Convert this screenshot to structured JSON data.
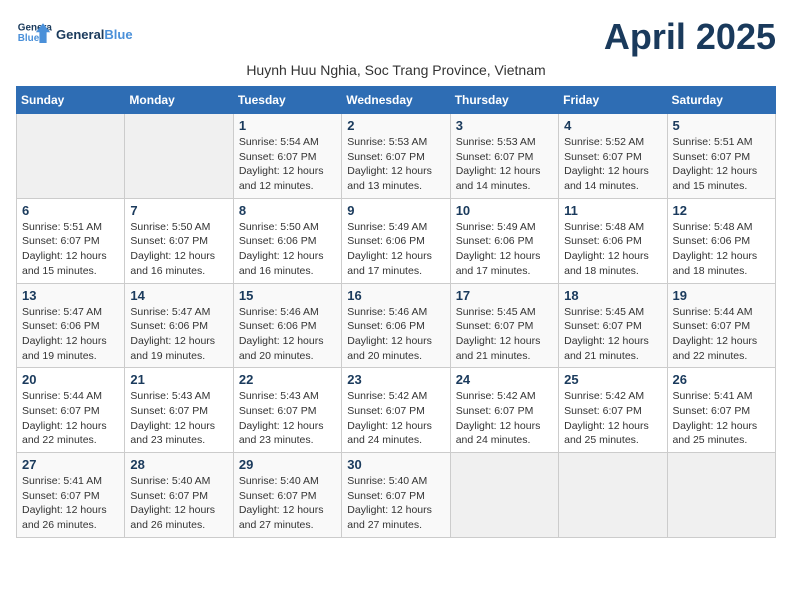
{
  "header": {
    "logo_line1": "General",
    "logo_line2": "Blue",
    "month_title": "April 2025",
    "subtitle": "Huynh Huu Nghia, Soc Trang Province, Vietnam"
  },
  "days_of_week": [
    "Sunday",
    "Monday",
    "Tuesday",
    "Wednesday",
    "Thursday",
    "Friday",
    "Saturday"
  ],
  "weeks": [
    [
      {
        "day": "",
        "info": ""
      },
      {
        "day": "",
        "info": ""
      },
      {
        "day": "1",
        "info": "Sunrise: 5:54 AM\nSunset: 6:07 PM\nDaylight: 12 hours\nand 12 minutes."
      },
      {
        "day": "2",
        "info": "Sunrise: 5:53 AM\nSunset: 6:07 PM\nDaylight: 12 hours\nand 13 minutes."
      },
      {
        "day": "3",
        "info": "Sunrise: 5:53 AM\nSunset: 6:07 PM\nDaylight: 12 hours\nand 14 minutes."
      },
      {
        "day": "4",
        "info": "Sunrise: 5:52 AM\nSunset: 6:07 PM\nDaylight: 12 hours\nand 14 minutes."
      },
      {
        "day": "5",
        "info": "Sunrise: 5:51 AM\nSunset: 6:07 PM\nDaylight: 12 hours\nand 15 minutes."
      }
    ],
    [
      {
        "day": "6",
        "info": "Sunrise: 5:51 AM\nSunset: 6:07 PM\nDaylight: 12 hours\nand 15 minutes."
      },
      {
        "day": "7",
        "info": "Sunrise: 5:50 AM\nSunset: 6:07 PM\nDaylight: 12 hours\nand 16 minutes."
      },
      {
        "day": "8",
        "info": "Sunrise: 5:50 AM\nSunset: 6:06 PM\nDaylight: 12 hours\nand 16 minutes."
      },
      {
        "day": "9",
        "info": "Sunrise: 5:49 AM\nSunset: 6:06 PM\nDaylight: 12 hours\nand 17 minutes."
      },
      {
        "day": "10",
        "info": "Sunrise: 5:49 AM\nSunset: 6:06 PM\nDaylight: 12 hours\nand 17 minutes."
      },
      {
        "day": "11",
        "info": "Sunrise: 5:48 AM\nSunset: 6:06 PM\nDaylight: 12 hours\nand 18 minutes."
      },
      {
        "day": "12",
        "info": "Sunrise: 5:48 AM\nSunset: 6:06 PM\nDaylight: 12 hours\nand 18 minutes."
      }
    ],
    [
      {
        "day": "13",
        "info": "Sunrise: 5:47 AM\nSunset: 6:06 PM\nDaylight: 12 hours\nand 19 minutes."
      },
      {
        "day": "14",
        "info": "Sunrise: 5:47 AM\nSunset: 6:06 PM\nDaylight: 12 hours\nand 19 minutes."
      },
      {
        "day": "15",
        "info": "Sunrise: 5:46 AM\nSunset: 6:06 PM\nDaylight: 12 hours\nand 20 minutes."
      },
      {
        "day": "16",
        "info": "Sunrise: 5:46 AM\nSunset: 6:06 PM\nDaylight: 12 hours\nand 20 minutes."
      },
      {
        "day": "17",
        "info": "Sunrise: 5:45 AM\nSunset: 6:07 PM\nDaylight: 12 hours\nand 21 minutes."
      },
      {
        "day": "18",
        "info": "Sunrise: 5:45 AM\nSunset: 6:07 PM\nDaylight: 12 hours\nand 21 minutes."
      },
      {
        "day": "19",
        "info": "Sunrise: 5:44 AM\nSunset: 6:07 PM\nDaylight: 12 hours\nand 22 minutes."
      }
    ],
    [
      {
        "day": "20",
        "info": "Sunrise: 5:44 AM\nSunset: 6:07 PM\nDaylight: 12 hours\nand 22 minutes."
      },
      {
        "day": "21",
        "info": "Sunrise: 5:43 AM\nSunset: 6:07 PM\nDaylight: 12 hours\nand 23 minutes."
      },
      {
        "day": "22",
        "info": "Sunrise: 5:43 AM\nSunset: 6:07 PM\nDaylight: 12 hours\nand 23 minutes."
      },
      {
        "day": "23",
        "info": "Sunrise: 5:42 AM\nSunset: 6:07 PM\nDaylight: 12 hours\nand 24 minutes."
      },
      {
        "day": "24",
        "info": "Sunrise: 5:42 AM\nSunset: 6:07 PM\nDaylight: 12 hours\nand 24 minutes."
      },
      {
        "day": "25",
        "info": "Sunrise: 5:42 AM\nSunset: 6:07 PM\nDaylight: 12 hours\nand 25 minutes."
      },
      {
        "day": "26",
        "info": "Sunrise: 5:41 AM\nSunset: 6:07 PM\nDaylight: 12 hours\nand 25 minutes."
      }
    ],
    [
      {
        "day": "27",
        "info": "Sunrise: 5:41 AM\nSunset: 6:07 PM\nDaylight: 12 hours\nand 26 minutes."
      },
      {
        "day": "28",
        "info": "Sunrise: 5:40 AM\nSunset: 6:07 PM\nDaylight: 12 hours\nand 26 minutes."
      },
      {
        "day": "29",
        "info": "Sunrise: 5:40 AM\nSunset: 6:07 PM\nDaylight: 12 hours\nand 27 minutes."
      },
      {
        "day": "30",
        "info": "Sunrise: 5:40 AM\nSunset: 6:07 PM\nDaylight: 12 hours\nand 27 minutes."
      },
      {
        "day": "",
        "info": ""
      },
      {
        "day": "",
        "info": ""
      },
      {
        "day": "",
        "info": ""
      }
    ]
  ]
}
